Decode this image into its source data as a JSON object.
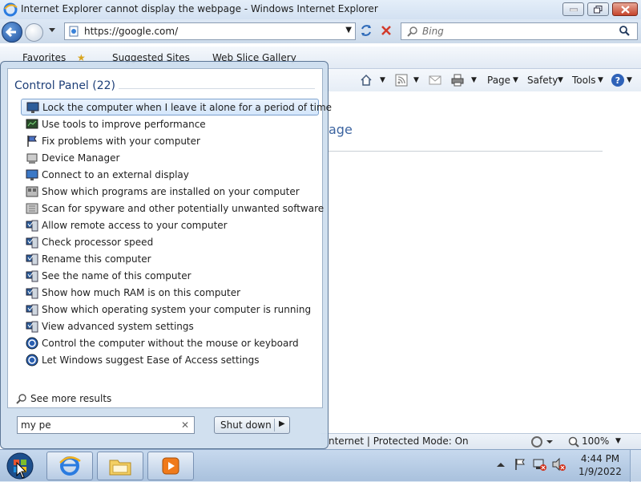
{
  "window": {
    "title": "Internet Explorer cannot display the webpage - Windows Internet Explorer"
  },
  "navbar": {
    "url": "https://google.com/",
    "search_placeholder": "Bing"
  },
  "favorites_bar": {
    "favorites_label": "Favorites",
    "suggested_sites_label": "Suggested Sites",
    "web_slice_label": "Web Slice Gallery"
  },
  "command_bar": {
    "page_label": "Page",
    "safety_label": "Safety",
    "tools_label": "Tools"
  },
  "content": {
    "heading_fragment": "age"
  },
  "status_bar": {
    "zone_text": "nternet | Protected Mode: On",
    "zoom": "100%"
  },
  "start_menu": {
    "group_title": "Control Panel (22)",
    "items": [
      {
        "label": "Lock the computer when I leave it alone for a period of time",
        "icon": "monitor-lock-icon"
      },
      {
        "label": "Use tools to improve performance",
        "icon": "performance-icon"
      },
      {
        "label": "Fix problems with your computer",
        "icon": "action-center-flag-icon"
      },
      {
        "label": "Device Manager",
        "icon": "device-manager-icon"
      },
      {
        "label": "Connect to an external display",
        "icon": "display-icon"
      },
      {
        "label": "Show which programs are installed on your computer",
        "icon": "programs-icon"
      },
      {
        "label": "Scan for spyware and other potentially unwanted software",
        "icon": "defender-icon"
      },
      {
        "label": "Allow remote access to your computer",
        "icon": "system-icon"
      },
      {
        "label": "Check processor speed",
        "icon": "system-icon"
      },
      {
        "label": "Rename this computer",
        "icon": "system-icon"
      },
      {
        "label": "See the name of this computer",
        "icon": "system-icon"
      },
      {
        "label": "Show how much RAM is on this computer",
        "icon": "system-icon"
      },
      {
        "label": "Show which operating system your computer is running",
        "icon": "system-icon"
      },
      {
        "label": "View advanced system settings",
        "icon": "system-icon"
      },
      {
        "label": "Control the computer without the mouse or keyboard",
        "icon": "ease-of-access-icon"
      },
      {
        "label": "Let Windows suggest Ease of Access settings",
        "icon": "ease-of-access-icon"
      }
    ],
    "see_more": "See more results",
    "search_value": "my pe",
    "shutdown_label": "Shut down"
  },
  "taskbar": {
    "clock_time": "4:44 PM",
    "clock_date": "1/9/2022"
  },
  "colors": {
    "accent": "#3c64a0",
    "selection": "#d4e6fb",
    "taskbar": "#b5cce6"
  }
}
